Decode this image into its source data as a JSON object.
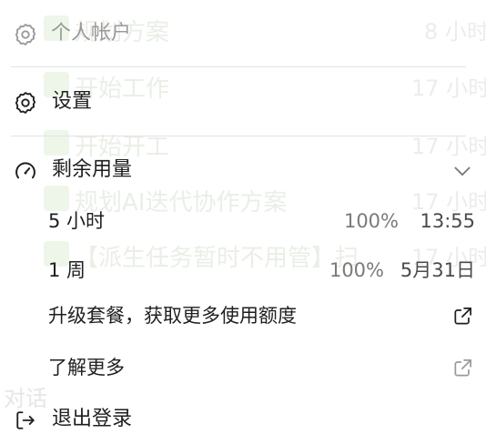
{
  "background": {
    "rows": [
      {
        "text": "规划方案",
        "time": "8 小时"
      },
      {
        "text": "开始工作",
        "time": "17 小时"
      },
      {
        "text": "开始开工",
        "time": "17 小时"
      },
      {
        "text": "规划AI迭代协作方案",
        "time": "17 小时"
      },
      {
        "text": "【派生任务暂时不用管】扫",
        "time": "17 小时"
      }
    ],
    "section_label": "对话"
  },
  "menu": {
    "account_label": "个人帐户",
    "settings_label": "设置",
    "usage": {
      "label": "剩余用量",
      "rows": [
        {
          "name": "5 小时",
          "percent": "100%",
          "reset": "13:55"
        },
        {
          "name": "1 周",
          "percent": "100%",
          "reset": "5月31日"
        }
      ]
    },
    "upgrade_label": "升级套餐，获取更多使用额度",
    "learn_more_label": "了解更多",
    "logout_label": "退出登录"
  },
  "icons": {
    "account": "gear-icon",
    "settings": "gear-icon",
    "usage": "gauge-icon",
    "usage_toggle": "chevron-down-icon",
    "upgrade": "external-link-icon",
    "learn_more": "external-link-icon",
    "logout": "logout-icon"
  },
  "colors": {
    "text": "#1f1f1f",
    "muted": "#9a9a9a",
    "divider": "#e3e3e3",
    "background_fade_green": "#eef6ea"
  }
}
